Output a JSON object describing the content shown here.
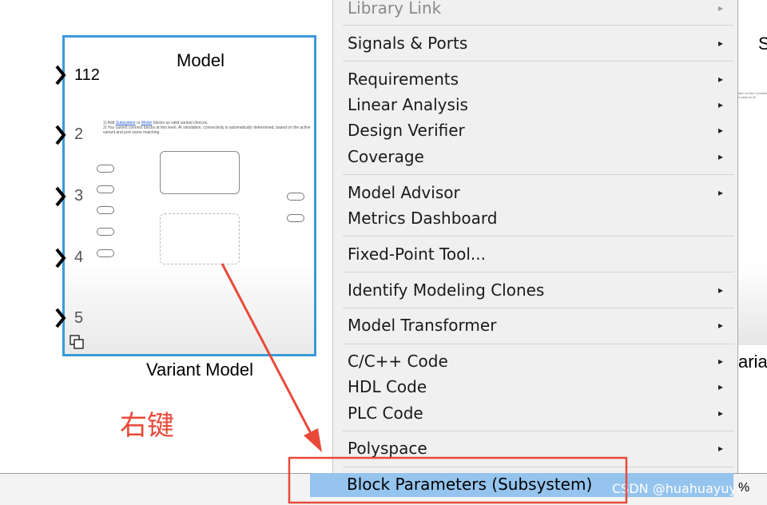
{
  "canvas": {
    "block": {
      "title": "Model",
      "ports": [
        "112",
        "2",
        "3",
        "4",
        "5"
      ],
      "notes_line1_prefix": "1) Add ",
      "notes_link1": "Subsystem",
      "notes_or": " or ",
      "notes_link2": "Model",
      "notes_line1_suffix": " blocks as valid variant choices.",
      "notes_line2": "2) You cannot connect blocks at this level. At simulation, connectivity is automatically determined, based on the active variant and port name matching.",
      "caption": "Variant Model"
    },
    "block2": {
      "title_partial": "S",
      "notes_partial": "stem or Mo t connect bl ased on th",
      "caption_partial": "aria"
    },
    "annotation_text": "右键"
  },
  "menu": {
    "items": [
      {
        "label": "Library Link",
        "submenu": true,
        "disabled": true
      },
      {
        "label": "Signals & Ports",
        "submenu": true
      },
      {
        "label": "Requirements",
        "submenu": true
      },
      {
        "label": "Linear Analysis",
        "submenu": true
      },
      {
        "label": "Design Verifier",
        "submenu": true
      },
      {
        "label": "Coverage",
        "submenu": true
      },
      {
        "label": "Model Advisor",
        "submenu": true
      },
      {
        "label": "Metrics Dashboard",
        "submenu": false
      },
      {
        "label": "Fixed-Point Tool...",
        "submenu": false
      },
      {
        "label": "Identify Modeling Clones",
        "submenu": true
      },
      {
        "label": "Model Transformer",
        "submenu": true
      },
      {
        "label": "C/C++ Code",
        "submenu": true
      },
      {
        "label": "HDL Code",
        "submenu": true
      },
      {
        "label": "PLC Code",
        "submenu": true
      },
      {
        "label": "Polyspace",
        "submenu": true
      },
      {
        "label": "Block Parameters (Subsystem)",
        "submenu": false,
        "highlighted": true
      }
    ],
    "arrow_glyph": "▸"
  },
  "statusbar": {
    "zoom_partial": "%",
    "watermark": "CSDN @huahuayuyu"
  },
  "colors": {
    "block_border": "#3a9ad9",
    "highlight": "#95c4ee",
    "annotation_red": "#e84a3a"
  }
}
